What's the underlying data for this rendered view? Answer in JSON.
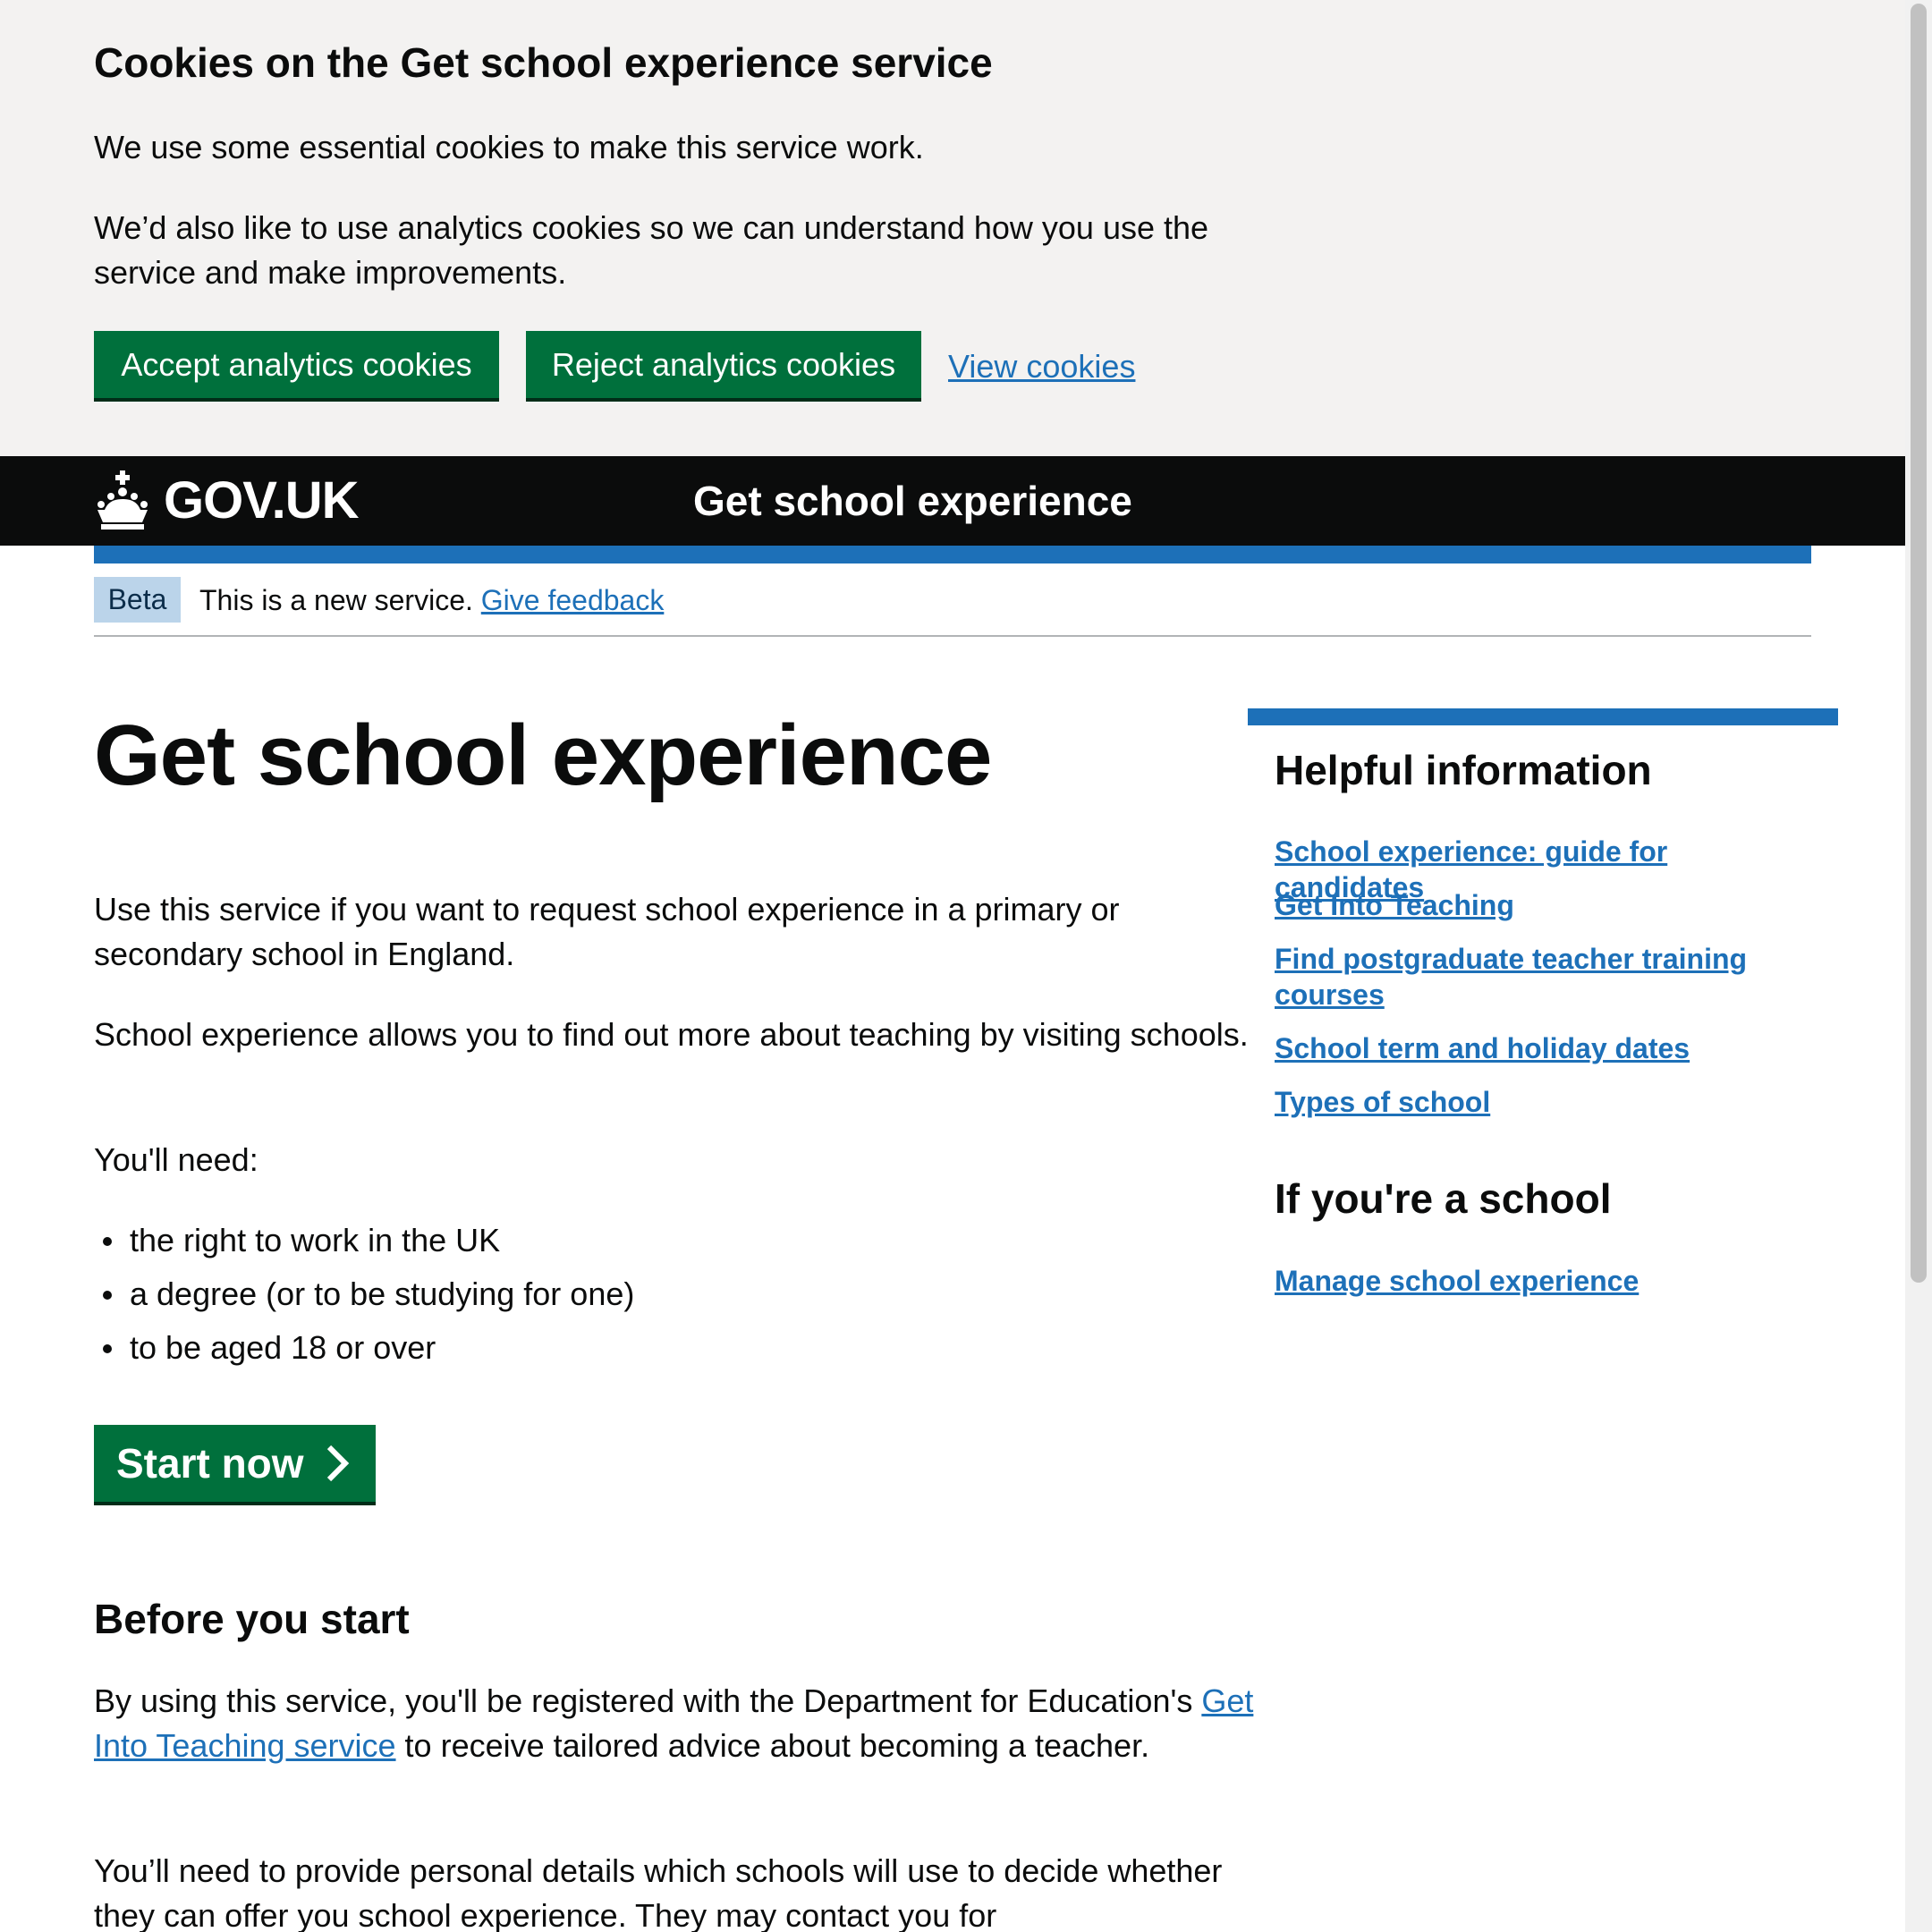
{
  "cookie_banner": {
    "heading": "Cookies on the Get school experience service",
    "paragraph1": "We use some essential cookies to make this service work.",
    "paragraph2": "We’d also like to use analytics cookies so we can understand how you use the service and make improvements.",
    "accept_label": "Accept analytics cookies",
    "reject_label": "Reject analytics cookies",
    "view_label": "View cookies"
  },
  "header": {
    "logo_text": "GOV.UK",
    "logo_icon": "crown-icon",
    "service_name": "Get school experience"
  },
  "phase_banner": {
    "tag": "Beta",
    "text": "This is a new service. ",
    "link": "Give feedback"
  },
  "main": {
    "title": "Get school experience",
    "intro1": "Use this service if you want to request school experience in a primary or secondary school in England.",
    "intro2": "School experience allows you to find out more about teaching by visiting schools.",
    "need_label": "You'll need:",
    "needs": [
      "the right to work in the UK",
      "a degree (or to be studying for one)",
      "to be aged 18 or over"
    ],
    "start_label": "Start now",
    "before_heading": "Before you start",
    "before1_pre": "By using this service, you'll be registered with the Department for Education's ",
    "before1_link": "Get Into Teaching service",
    "before1_post": " to receive tailored advice about becoming a teacher.",
    "before2": "You’ll need to provide personal details which schools will use to decide whether they can offer you school experience. They may contact you for"
  },
  "sidebar": {
    "helpful_heading": "Helpful information",
    "links": [
      "School experience: guide for candidates",
      "Get Into Teaching",
      "Find postgraduate teacher training courses",
      "School term and holiday dates",
      "Types of school"
    ],
    "school_heading": "If you're a school",
    "school_link": "Manage school experience"
  },
  "colors": {
    "brand_green": "#00703c",
    "link_blue": "#1d70b8",
    "header_black": "#0b0c0c",
    "banner_grey": "#f3f2f1",
    "tag_blue": "#bbd4ea"
  }
}
